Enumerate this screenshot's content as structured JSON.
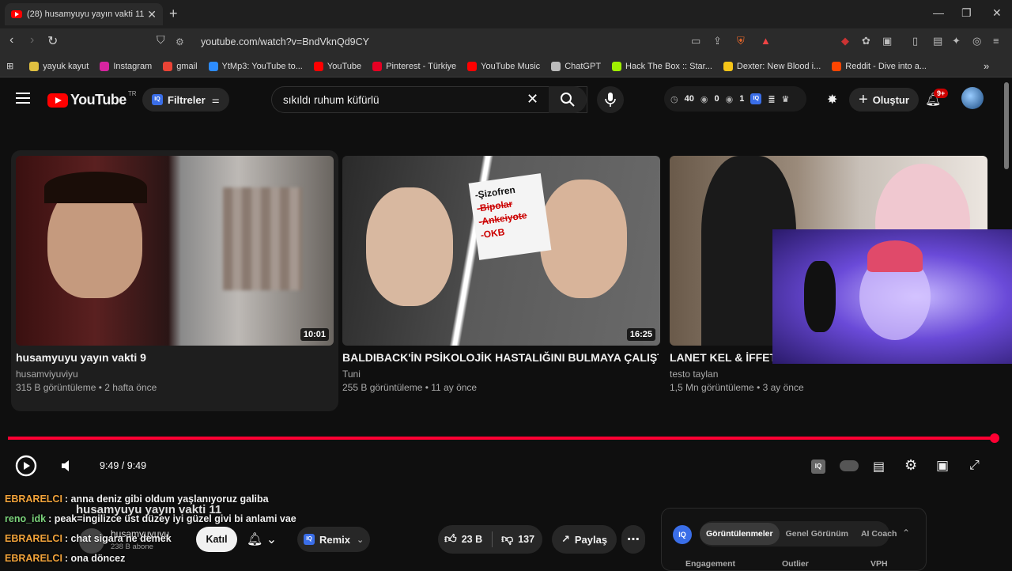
{
  "browser": {
    "tab_title": "(28) husamyuyu yayın vakti 11 -",
    "url": "youtube.com/watch?v=BndVknQd9CY",
    "bookmarks": [
      {
        "label": "yayuk kayut",
        "color": "#e0c040"
      },
      {
        "label": "Instagram",
        "color": "#d6249f"
      },
      {
        "label": "gmail",
        "color": "#ea4335"
      },
      {
        "label": "YtMp3: YouTube to...",
        "color": "#2d8cff"
      },
      {
        "label": "YouTube",
        "color": "#ff0000"
      },
      {
        "label": "Pinterest - Türkiye",
        "color": "#e60023"
      },
      {
        "label": "YouTube Music",
        "color": "#ff0000"
      },
      {
        "label": "ChatGPT",
        "color": "#bbbbbb"
      },
      {
        "label": "Hack The Box :: Star...",
        "color": "#9fef00"
      },
      {
        "label": "Dexter: New Blood i...",
        "color": "#f5c518"
      },
      {
        "label": "Reddit - Dive into a...",
        "color": "#ff4500"
      }
    ]
  },
  "yt_header": {
    "logo_text": "YouTube",
    "country": "TR",
    "filters_label": "Filtreler",
    "search_value": "sıkıldı ruhum küfürlü",
    "stats": [
      "40",
      "0",
      "1"
    ],
    "create_label": "Oluştur",
    "notifications": "9+"
  },
  "videos": [
    {
      "title": "husamyuyu yayın vakti 9",
      "channel": "husamviyuviyu",
      "meta": "315 B görüntüleme • 2 hafta önce",
      "duration": "10:01"
    },
    {
      "title": "BALDIBACK'İN PSİKOLOJİK HASTALIĞINI BULMAYA ÇALIŞTIM",
      "channel": "Tuni",
      "meta": "255 B görüntüleme • 11 ay önce",
      "duration": "16:25",
      "thumb_note": [
        "-Şizofren",
        "-Bipolar",
        "-Ankeiyote",
        "-OKB"
      ]
    },
    {
      "title": "LANET KEL & İFFETS",
      "channel": "testo taylan",
      "meta": "1,5 Mn görüntüleme • 3 ay önce",
      "duration": ""
    }
  ],
  "player": {
    "time": "9:49 / 9:49",
    "progress": 1.0,
    "accent": "#ff0033"
  },
  "chat": [
    {
      "user": "EBRARELCI",
      "msg": ": anna deniz gibi oldum yaşlanıyoruz galiba",
      "color": "orange"
    },
    {
      "user": "reno_idk",
      "msg": ": peak=ingilizce üst düzey iyi güzel givi bi anlami vae",
      "color": "green"
    },
    {
      "user": "EBRARELCI",
      "msg": ": chat sigara ne demek",
      "color": "orange"
    },
    {
      "user": "EBRARELCI",
      "msg": ": ona döncez",
      "color": "orange"
    }
  ],
  "below": {
    "video_title": "husamyuyu yayın vakti 11",
    "channel_name": "husamyuyuyu",
    "subs": "238 B abone",
    "join_label": "Katıl",
    "remix_label": "Remix",
    "likes": "23 B",
    "dislikes": "137",
    "share_label": "Paylaş",
    "iq_tabs": [
      "Görüntülenmeler",
      "Genel Görünüm",
      "AI Coach"
    ],
    "iq_columns": [
      "Engagement",
      "Outlier",
      "VPH"
    ]
  }
}
